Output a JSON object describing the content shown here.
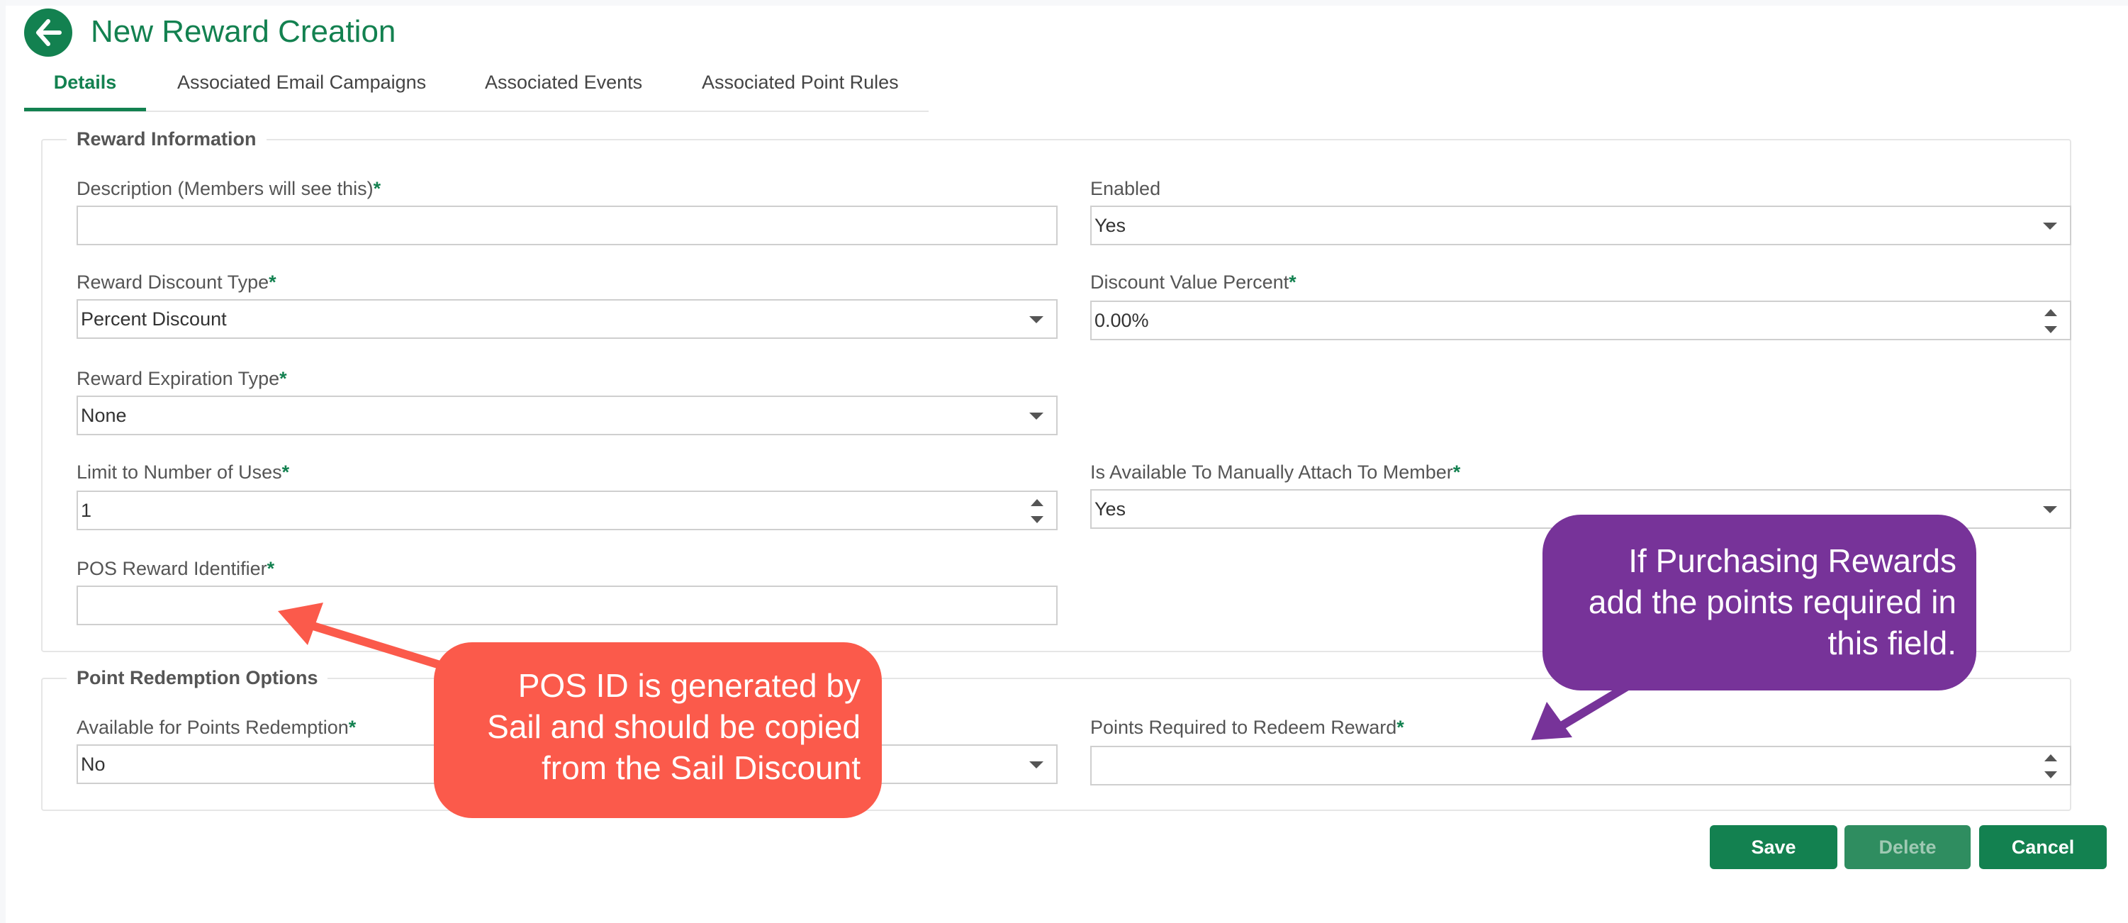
{
  "header": {
    "title": "New Reward Creation"
  },
  "tabs": [
    {
      "label": "Details",
      "active": true
    },
    {
      "label": "Associated Email Campaigns",
      "active": false
    },
    {
      "label": "Associated Events",
      "active": false
    },
    {
      "label": "Associated Point Rules",
      "active": false
    }
  ],
  "reward_info": {
    "legend": "Reward Information",
    "description_label": "Description (Members will see this)",
    "description_value": "",
    "enabled_label": "Enabled",
    "enabled_value": "Yes",
    "discount_type_label": "Reward Discount Type",
    "discount_type_value": "Percent Discount",
    "discount_percent_label": "Discount Value Percent",
    "discount_percent_value": "0.00%",
    "expiration_type_label": "Reward Expiration Type",
    "expiration_type_value": "None",
    "limit_uses_label": "Limit to Number of Uses",
    "limit_uses_value": "1",
    "manual_attach_label": "Is Available To Manually Attach To Member",
    "manual_attach_value": "Yes",
    "pos_id_label": "POS Reward Identifier",
    "pos_id_value": ""
  },
  "redemption": {
    "legend": "Point Redemption Options",
    "available_label": "Available for Points Redemption",
    "available_value": "No",
    "points_required_label": "Points Required to Redeem Reward",
    "points_required_value": ""
  },
  "required_marker": "*",
  "buttons": {
    "save": "Save",
    "delete": "Delete",
    "cancel": "Cancel"
  },
  "callouts": {
    "pos_id": [
      "POS ID is generated by",
      "Sail and should be copied",
      "from the Sail Discount"
    ],
    "purchasing": [
      "If Purchasing Rewards",
      "add the points required in",
      "this field."
    ]
  },
  "colors": {
    "brand_green": "#138150",
    "callout_red": "#fb5a4b",
    "callout_purple": "#773399"
  },
  "icons": {
    "back": "arrow-left-circle-icon",
    "select": "chevron-down-icon",
    "spinner": "spinner-arrows-icon"
  }
}
